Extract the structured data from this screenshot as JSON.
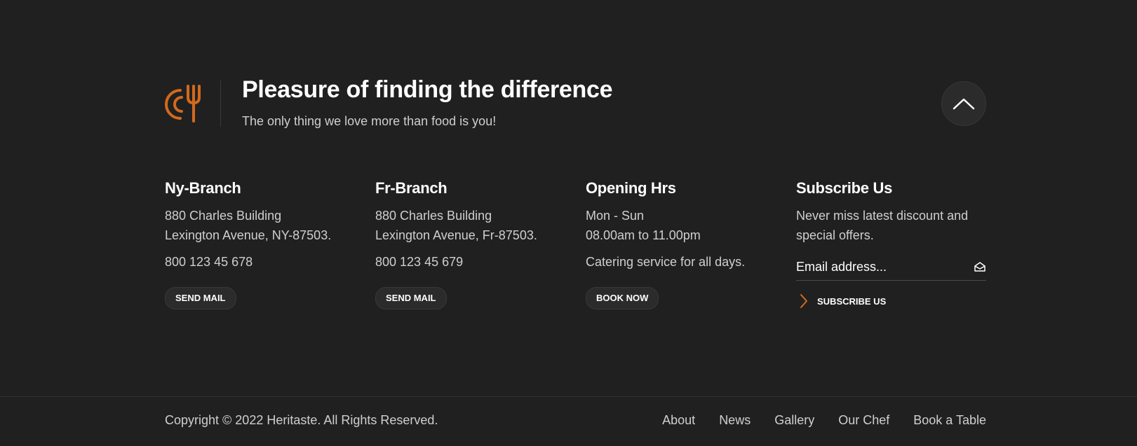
{
  "brand": {
    "title": "Pleasure of finding the difference",
    "subtitle": "The only thing we love more than food is you!",
    "logo_icon": "plate-fork-icon",
    "accent_color": "#d2691e"
  },
  "scroll_top": {
    "icon": "chevron-up-icon"
  },
  "columns": {
    "ny": {
      "heading": "Ny-Branch",
      "address_line1": "880 Charles Building",
      "address_line2": "Lexington Avenue, NY-87503.",
      "phone": "800 123 45 678",
      "button": "SEND MAIL"
    },
    "fr": {
      "heading": "Fr-Branch",
      "address_line1": "880 Charles Building",
      "address_line2": "Lexington Avenue, Fr-87503.",
      "phone": "800 123 45 679",
      "button": "SEND MAIL"
    },
    "hours": {
      "heading": "Opening Hrs",
      "days": "Mon - Sun",
      "time": "08.00am to 11.00pm",
      "note": "Catering service for all days.",
      "button": "BOOK NOW"
    },
    "subscribe": {
      "heading": "Subscribe Us",
      "text_line1": "Never miss latest discount and",
      "text_line2": "special offers.",
      "email_placeholder": "Email address...",
      "email_icon": "envelope-open-icon",
      "button": "SUBSCRIBE US",
      "button_icon": "chevron-right-icon"
    }
  },
  "bottom": {
    "copyright": "Copyright © 2022 Heritaste. All Rights Reserved.",
    "nav": [
      "About",
      "News",
      "Gallery",
      "Our Chef",
      "Book a Table"
    ]
  }
}
